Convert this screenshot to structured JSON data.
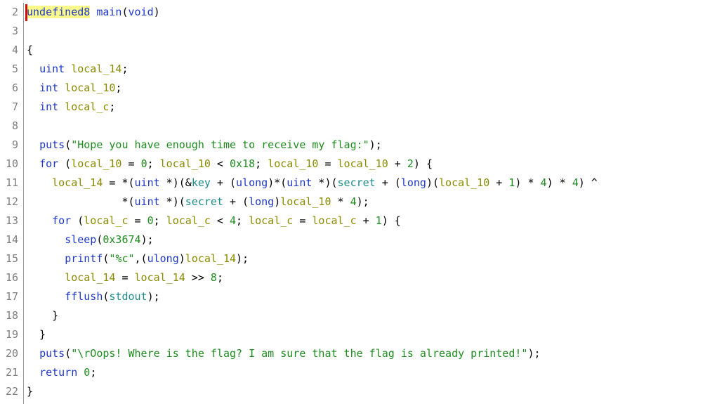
{
  "editor": {
    "lines": [
      {
        "n": "2",
        "tokens": [
          {
            "t": "undefined8",
            "c": "t-hl"
          },
          {
            "t": " ",
            "c": "t-op"
          },
          {
            "t": "main",
            "c": "t-func"
          },
          {
            "t": "(",
            "c": "t-op"
          },
          {
            "t": "void",
            "c": "t-type"
          },
          {
            "t": ")",
            "c": "t-op"
          }
        ]
      },
      {
        "n": "3",
        "tokens": []
      },
      {
        "n": "4",
        "tokens": [
          {
            "t": "{",
            "c": "t-op"
          }
        ]
      },
      {
        "n": "5",
        "tokens": [
          {
            "t": "  ",
            "c": "t-op"
          },
          {
            "t": "uint",
            "c": "t-type"
          },
          {
            "t": " ",
            "c": "t-op"
          },
          {
            "t": "local_14",
            "c": "t-var"
          },
          {
            "t": ";",
            "c": "t-op"
          }
        ]
      },
      {
        "n": "6",
        "tokens": [
          {
            "t": "  ",
            "c": "t-op"
          },
          {
            "t": "int",
            "c": "t-type"
          },
          {
            "t": " ",
            "c": "t-op"
          },
          {
            "t": "local_10",
            "c": "t-var"
          },
          {
            "t": ";",
            "c": "t-op"
          }
        ]
      },
      {
        "n": "7",
        "tokens": [
          {
            "t": "  ",
            "c": "t-op"
          },
          {
            "t": "int",
            "c": "t-type"
          },
          {
            "t": " ",
            "c": "t-op"
          },
          {
            "t": "local_c",
            "c": "t-var"
          },
          {
            "t": ";",
            "c": "t-op"
          }
        ]
      },
      {
        "n": "8",
        "tokens": []
      },
      {
        "n": "9",
        "tokens": [
          {
            "t": "  ",
            "c": "t-op"
          },
          {
            "t": "puts",
            "c": "t-func"
          },
          {
            "t": "(",
            "c": "t-op"
          },
          {
            "t": "\"Hope you have enough time to receive my flag:\"",
            "c": "t-str"
          },
          {
            "t": ");",
            "c": "t-op"
          }
        ]
      },
      {
        "n": "10",
        "tokens": [
          {
            "t": "  ",
            "c": "t-op"
          },
          {
            "t": "for",
            "c": "t-kw"
          },
          {
            "t": " (",
            "c": "t-op"
          },
          {
            "t": "local_10",
            "c": "t-var"
          },
          {
            "t": " = ",
            "c": "t-op"
          },
          {
            "t": "0",
            "c": "t-num"
          },
          {
            "t": "; ",
            "c": "t-op"
          },
          {
            "t": "local_10",
            "c": "t-var"
          },
          {
            "t": " < ",
            "c": "t-op"
          },
          {
            "t": "0x18",
            "c": "t-num"
          },
          {
            "t": "; ",
            "c": "t-op"
          },
          {
            "t": "local_10",
            "c": "t-var"
          },
          {
            "t": " = ",
            "c": "t-op"
          },
          {
            "t": "local_10",
            "c": "t-var"
          },
          {
            "t": " + ",
            "c": "t-op"
          },
          {
            "t": "2",
            "c": "t-num"
          },
          {
            "t": ") {",
            "c": "t-op"
          }
        ]
      },
      {
        "n": "11",
        "tokens": [
          {
            "t": "    ",
            "c": "t-op"
          },
          {
            "t": "local_14",
            "c": "t-var"
          },
          {
            "t": " = *(",
            "c": "t-op"
          },
          {
            "t": "uint",
            "c": "t-type"
          },
          {
            "t": " *)(&",
            "c": "t-op"
          },
          {
            "t": "key",
            "c": "t-glob"
          },
          {
            "t": " + (",
            "c": "t-op"
          },
          {
            "t": "ulong",
            "c": "t-type"
          },
          {
            "t": ")*(",
            "c": "t-op"
          },
          {
            "t": "uint",
            "c": "t-type"
          },
          {
            "t": " *)(",
            "c": "t-op"
          },
          {
            "t": "secret",
            "c": "t-glob"
          },
          {
            "t": " + (",
            "c": "t-op"
          },
          {
            "t": "long",
            "c": "t-type"
          },
          {
            "t": ")(",
            "c": "t-op"
          },
          {
            "t": "local_10",
            "c": "t-var"
          },
          {
            "t": " + ",
            "c": "t-op"
          },
          {
            "t": "1",
            "c": "t-num"
          },
          {
            "t": ") * ",
            "c": "t-op"
          },
          {
            "t": "4",
            "c": "t-num"
          },
          {
            "t": ") * ",
            "c": "t-op"
          },
          {
            "t": "4",
            "c": "t-num"
          },
          {
            "t": ") ^",
            "c": "t-op"
          }
        ]
      },
      {
        "n": "12",
        "tokens": [
          {
            "t": "               *(",
            "c": "t-op"
          },
          {
            "t": "uint",
            "c": "t-type"
          },
          {
            "t": " *)(",
            "c": "t-op"
          },
          {
            "t": "secret",
            "c": "t-glob"
          },
          {
            "t": " + (",
            "c": "t-op"
          },
          {
            "t": "long",
            "c": "t-type"
          },
          {
            "t": ")",
            "c": "t-op"
          },
          {
            "t": "local_10",
            "c": "t-var"
          },
          {
            "t": " * ",
            "c": "t-op"
          },
          {
            "t": "4",
            "c": "t-num"
          },
          {
            "t": ");",
            "c": "t-op"
          }
        ]
      },
      {
        "n": "13",
        "tokens": [
          {
            "t": "    ",
            "c": "t-op"
          },
          {
            "t": "for",
            "c": "t-kw"
          },
          {
            "t": " (",
            "c": "t-op"
          },
          {
            "t": "local_c",
            "c": "t-var"
          },
          {
            "t": " = ",
            "c": "t-op"
          },
          {
            "t": "0",
            "c": "t-num"
          },
          {
            "t": "; ",
            "c": "t-op"
          },
          {
            "t": "local_c",
            "c": "t-var"
          },
          {
            "t": " < ",
            "c": "t-op"
          },
          {
            "t": "4",
            "c": "t-num"
          },
          {
            "t": "; ",
            "c": "t-op"
          },
          {
            "t": "local_c",
            "c": "t-var"
          },
          {
            "t": " = ",
            "c": "t-op"
          },
          {
            "t": "local_c",
            "c": "t-var"
          },
          {
            "t": " + ",
            "c": "t-op"
          },
          {
            "t": "1",
            "c": "t-num"
          },
          {
            "t": ") {",
            "c": "t-op"
          }
        ]
      },
      {
        "n": "14",
        "tokens": [
          {
            "t": "      ",
            "c": "t-op"
          },
          {
            "t": "sleep",
            "c": "t-func"
          },
          {
            "t": "(",
            "c": "t-op"
          },
          {
            "t": "0x3674",
            "c": "t-num"
          },
          {
            "t": ");",
            "c": "t-op"
          }
        ]
      },
      {
        "n": "15",
        "tokens": [
          {
            "t": "      ",
            "c": "t-op"
          },
          {
            "t": "printf",
            "c": "t-func"
          },
          {
            "t": "(",
            "c": "t-op"
          },
          {
            "t": "\"%c\"",
            "c": "t-str"
          },
          {
            "t": ",(",
            "c": "t-op"
          },
          {
            "t": "ulong",
            "c": "t-type"
          },
          {
            "t": ")",
            "c": "t-op"
          },
          {
            "t": "local_14",
            "c": "t-var"
          },
          {
            "t": ");",
            "c": "t-op"
          }
        ]
      },
      {
        "n": "16",
        "tokens": [
          {
            "t": "      ",
            "c": "t-op"
          },
          {
            "t": "local_14",
            "c": "t-var"
          },
          {
            "t": " = ",
            "c": "t-op"
          },
          {
            "t": "local_14",
            "c": "t-var"
          },
          {
            "t": " >> ",
            "c": "t-op"
          },
          {
            "t": "8",
            "c": "t-num"
          },
          {
            "t": ";",
            "c": "t-op"
          }
        ]
      },
      {
        "n": "17",
        "tokens": [
          {
            "t": "      ",
            "c": "t-op"
          },
          {
            "t": "fflush",
            "c": "t-func"
          },
          {
            "t": "(",
            "c": "t-op"
          },
          {
            "t": "stdout",
            "c": "t-glob"
          },
          {
            "t": ");",
            "c": "t-op"
          }
        ]
      },
      {
        "n": "18",
        "tokens": [
          {
            "t": "    }",
            "c": "t-op"
          }
        ]
      },
      {
        "n": "19",
        "tokens": [
          {
            "t": "  }",
            "c": "t-op"
          }
        ]
      },
      {
        "n": "20",
        "tokens": [
          {
            "t": "  ",
            "c": "t-op"
          },
          {
            "t": "puts",
            "c": "t-func"
          },
          {
            "t": "(",
            "c": "t-op"
          },
          {
            "t": "\"\\rOops! Where is the flag? I am sure that the flag is already printed!\"",
            "c": "t-str"
          },
          {
            "t": ");",
            "c": "t-op"
          }
        ]
      },
      {
        "n": "21",
        "tokens": [
          {
            "t": "  ",
            "c": "t-op"
          },
          {
            "t": "return",
            "c": "t-kw"
          },
          {
            "t": " ",
            "c": "t-op"
          },
          {
            "t": "0",
            "c": "t-num"
          },
          {
            "t": ";",
            "c": "t-op"
          }
        ]
      },
      {
        "n": "22",
        "tokens": [
          {
            "t": "}",
            "c": "t-op"
          }
        ]
      }
    ]
  }
}
